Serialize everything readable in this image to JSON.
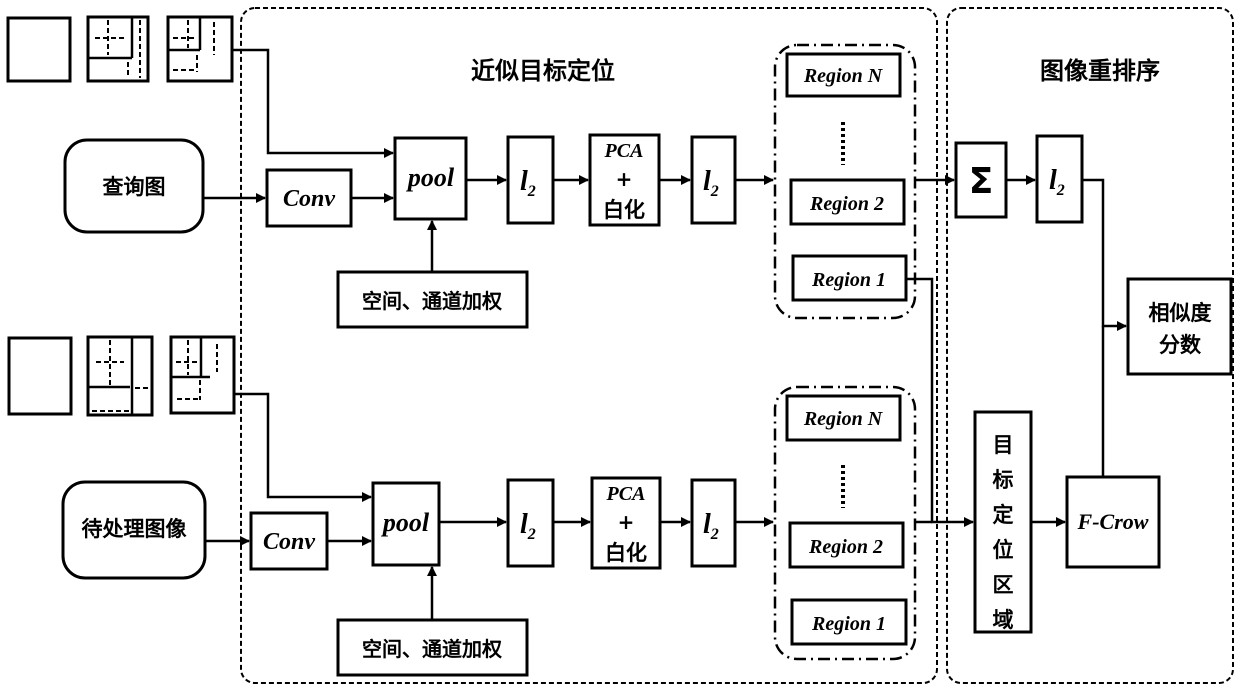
{
  "sections": {
    "localization_title": "近似目标定位",
    "reranking_title": "图像重排序"
  },
  "inputs": {
    "query": "查询图",
    "candidate": "待处理图像"
  },
  "pipeline": {
    "conv": "Conv",
    "pool": "pool",
    "l2_base": "l",
    "l2_sub": "2",
    "pca_line1": "PCA",
    "pca_line2": "+",
    "pca_line3": "白化",
    "weighting": "空间、通道加权"
  },
  "regions": {
    "top": [
      "Region N",
      "Region 2",
      "Region 1"
    ],
    "bottom": [
      "Region N",
      "Region 2",
      "Region 1"
    ],
    "ellipsis": "⋮"
  },
  "reranking": {
    "sum_symbol": "Σ",
    "l2_base": "l",
    "l2_sub": "2",
    "similarity_line1": "相似度",
    "similarity_line2": "分数",
    "target_region_chars": [
      "目",
      "标",
      "定",
      "位",
      "区",
      "域"
    ],
    "fcrow": "F-Crow"
  }
}
